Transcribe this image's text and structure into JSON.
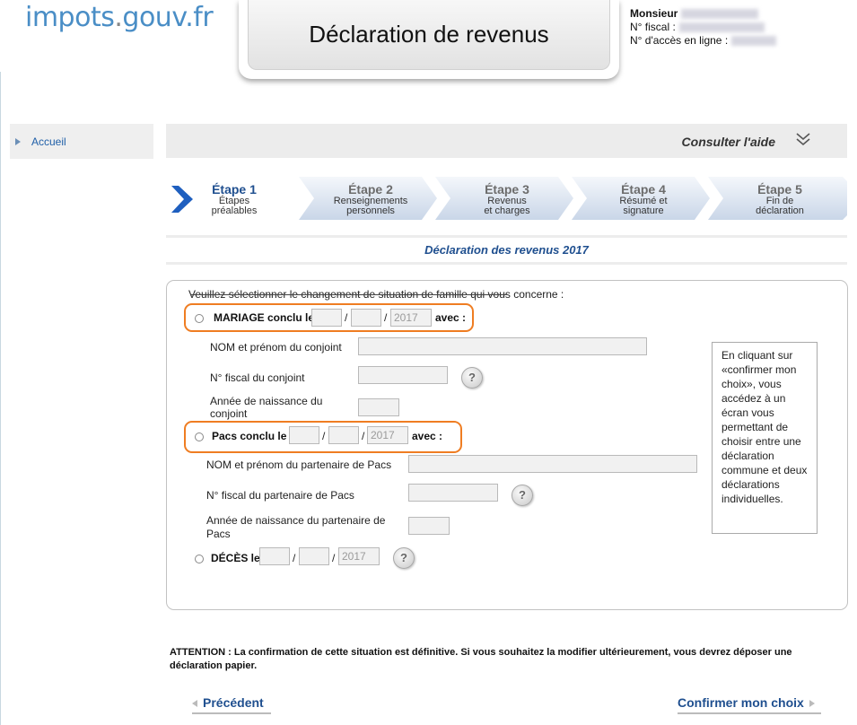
{
  "header": {
    "logo_main": "impots",
    "logo_dot": ".",
    "logo_tail": "gouv.fr",
    "title": "Déclaration de revenus",
    "user_label": "Monsieur",
    "fiscal_label": "N° fiscal :",
    "access_label": "N° d'accès en ligne :"
  },
  "sidebar": {
    "items": [
      {
        "label": "Accueil"
      }
    ]
  },
  "help": {
    "label": "Consulter l'aide",
    "icon": "double-chevron-down-icon"
  },
  "steps": [
    {
      "title": "Étape 1",
      "line1": "Étapes",
      "line2": "préalables",
      "active": true
    },
    {
      "title": "Étape 2",
      "line1": "Renseignements",
      "line2": "personnels",
      "active": false
    },
    {
      "title": "Étape 3",
      "line1": "Revenus",
      "line2": "et charges",
      "active": false
    },
    {
      "title": "Étape 4",
      "line1": "Résumé et",
      "line2": "signature",
      "active": false
    },
    {
      "title": "Étape 5",
      "line1": "Fin de",
      "line2": "déclaration",
      "active": false
    }
  ],
  "section_title": "Déclaration des revenus 2017",
  "form": {
    "intro": "Veuillez sélectionner le changement de situation de famille qui vous concerne :",
    "mariage": {
      "label": "MARIAGE conclu le",
      "avec": "avec :",
      "year": "2017",
      "name_label": "NOM et prénom du conjoint",
      "fiscal_label": "N° fiscal du conjoint",
      "birth_label_1": "Année de naissance du",
      "birth_label_2": "conjoint"
    },
    "pacs": {
      "label": "Pacs conclu le",
      "avec": "avec :",
      "year": "2017",
      "name_label": "NOM et prénom du partenaire de Pacs",
      "fiscal_label": "N° fiscal du partenaire de Pacs",
      "birth_label_1": "Année de naissance du partenaire de",
      "birth_label_2": "Pacs"
    },
    "deces": {
      "label": "DÉCÈS le",
      "year": "2017"
    },
    "slash": "/",
    "help_glyph": "?",
    "note": "En cliquant sur «confirmer mon choix», vous accédez à un écran vous permettant de choisir entre une déclaration commune et deux déclarations individuelles."
  },
  "attention": "ATTENTION : La confirmation de cette situation est définitive. Si vous souhaitez la modifier ultérieurement, vous devrez déposer une déclaration papier.",
  "nav": {
    "prev": "Précédent",
    "next": "Confirmer mon choix"
  },
  "colors": {
    "accent": "#1f4f8f",
    "highlight": "#ef7d22",
    "logo": "#4a8ec6"
  }
}
